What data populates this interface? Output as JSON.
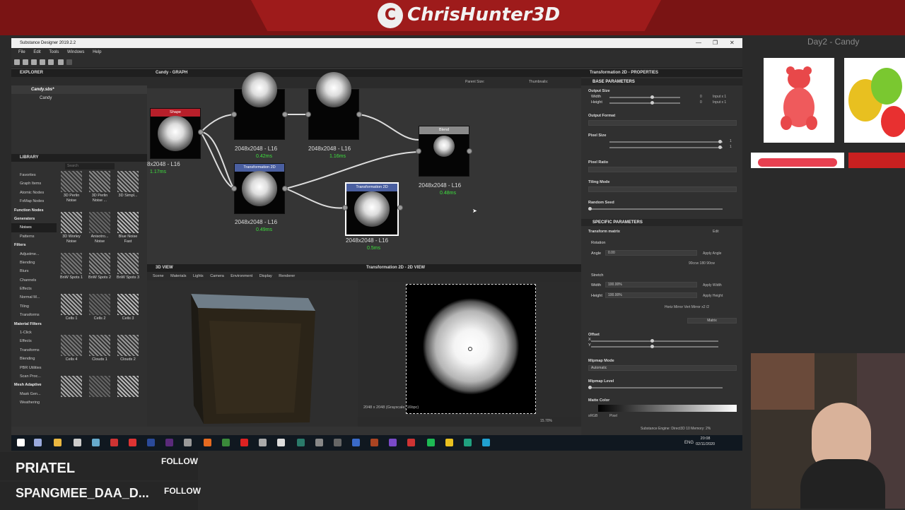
{
  "stream": {
    "brand": "ChrisHunter3D",
    "brand_logo": "C",
    "candy_title": "Day2 - Candy"
  },
  "app": {
    "title": "Substance Designer 2019.2.2",
    "menu": [
      "File",
      "Edit",
      "Tools",
      "Windows",
      "Help"
    ]
  },
  "explorer": {
    "title": "EXPLORER",
    "package": "Candy.sbs*",
    "graph": "Candy"
  },
  "library": {
    "title": "LIBRARY",
    "search_placeholder": "Search",
    "sidebar": [
      {
        "label": "Favorites",
        "head": false
      },
      {
        "label": "Graph Items",
        "head": false
      },
      {
        "label": "Atomic Nodes",
        "head": false
      },
      {
        "label": "FxMap Nodes",
        "head": false
      },
      {
        "label": "Function Nodes",
        "head": true
      },
      {
        "label": "Generators",
        "head": true
      },
      {
        "label": "Noises",
        "head": false,
        "selected": true
      },
      {
        "label": "Patterns",
        "head": false
      },
      {
        "label": "Filters",
        "head": true
      },
      {
        "label": "Adjustme...",
        "head": false
      },
      {
        "label": "Blending",
        "head": false
      },
      {
        "label": "Blurs",
        "head": false
      },
      {
        "label": "Channels",
        "head": false
      },
      {
        "label": "Effects",
        "head": false
      },
      {
        "label": "Normal M...",
        "head": false
      },
      {
        "label": "Tiling",
        "head": false
      },
      {
        "label": "Transforms",
        "head": false
      },
      {
        "label": "Material Filters",
        "head": true
      },
      {
        "label": "1-Click",
        "head": false
      },
      {
        "label": "Effects",
        "head": false
      },
      {
        "label": "Transforms",
        "head": false
      },
      {
        "label": "Blending",
        "head": false
      },
      {
        "label": "PBR Utilities",
        "head": false
      },
      {
        "label": "Scan Proc...",
        "head": false
      },
      {
        "label": "Mesh Adaptive",
        "head": true
      },
      {
        "label": "Mask Gen...",
        "head": false
      },
      {
        "label": "Weathering",
        "head": false
      }
    ],
    "items": [
      {
        "label": "3D Perlin Noise"
      },
      {
        "label": "3D Perlin Noise ..."
      },
      {
        "label": "3D Simpl..."
      },
      {
        "label": "3D Worley Noise"
      },
      {
        "label": "Anisotro... Noise"
      },
      {
        "label": "Blue Noise Fast"
      },
      {
        "label": "BnW Spots 1"
      },
      {
        "label": "BnW Spots 2"
      },
      {
        "label": "BnW Spots 3"
      },
      {
        "label": "Cells 1"
      },
      {
        "label": "Cells 2"
      },
      {
        "label": "Cells 3"
      },
      {
        "label": "Cells 4"
      },
      {
        "label": "Clouds 1"
      },
      {
        "label": "Clouds 2"
      },
      {
        "label": ""
      },
      {
        "label": ""
      },
      {
        "label": ""
      }
    ]
  },
  "graph": {
    "title": "Candy - GRAPH",
    "parent_size_label": "Parent Size:",
    "thumbnails_label": "Thumbnails:",
    "nodes": [
      {
        "name": "Shape",
        "size": "8x2048 - L16",
        "time": "1.17ms"
      },
      {
        "name": "",
        "size": "2048x2048 - L16",
        "time": "0.42ms"
      },
      {
        "name": "",
        "size": "2048x2048 - L16",
        "time": "1.16ms"
      },
      {
        "name": "Blend",
        "size": "2048x2048 - L16",
        "time": "0.48ms"
      },
      {
        "name": "Transformation 2D",
        "size": "2048x2048 - L16",
        "time": "0.49ms"
      },
      {
        "name": "Transformation 2D",
        "size": "2048x2048 - L16",
        "time": "0.5ms"
      }
    ]
  },
  "view3d": {
    "title": "3D VIEW",
    "menu": [
      "Scene",
      "Materials",
      "Lights",
      "Camera",
      "Environment",
      "Display",
      "Renderer"
    ]
  },
  "view2d": {
    "title": "Transformation 2D - 2D VIEW",
    "status": "2048 x 2048 (Grayscale, 16bpc)",
    "zoom": "15.70%"
  },
  "props": {
    "title": "Transformation 2D - PROPERTIES",
    "base_params": "BASE PARAMETERS",
    "output_size": "Output Size",
    "width": "Width",
    "height": "Height",
    "input_x1": "Input x 1",
    "zero": "0",
    "output_format": "Output Format",
    "pixel_size": "Pixel Size",
    "one": "1",
    "pixel_ratio": "Pixel Ratio",
    "tiling_mode": "Tiling Mode",
    "random_seed": "Random Seed",
    "specific_params": "SPECIFIC PARAMETERS",
    "transform_matrix": "Transform matrix",
    "edit": "Edit",
    "rotation": "Rotation",
    "angle": "Angle",
    "angle_val": "0.00",
    "apply_angle": "Apply Angle",
    "angle_presets": "90ccw   180   90cw",
    "stretch": "Stretch",
    "stretch_w": "Width",
    "stretch_w_val": "100.00%",
    "stretch_h": "Height",
    "stretch_h_val": "100.00%",
    "apply_width": "Apply Width",
    "apply_height": "Apply Height",
    "mirror": "Horiz Mirror   Vert Mirror   x2   /2",
    "matrix_btn": "Matrix",
    "offset": "Offset",
    "x": "X",
    "y": "Y",
    "mipmap_mode": "Mipmap Mode",
    "mipmap_val": "Automatic",
    "mipmap_level": "Mipmap Level",
    "matte_color": "Matte Color",
    "srgb": "sRGB",
    "pixel": "Pixel"
  },
  "engine": "Substance Engine: Direct3D 10   Memory: 2%",
  "taskbar": {
    "lang": "ENG",
    "time": "20:08",
    "date": "02/11/2020"
  },
  "follows": [
    {
      "name": "PRIATEL",
      "label": "FOLLOW"
    },
    {
      "name": "SPANGMEE_DAA_D...",
      "label": "FOLLOW"
    }
  ]
}
